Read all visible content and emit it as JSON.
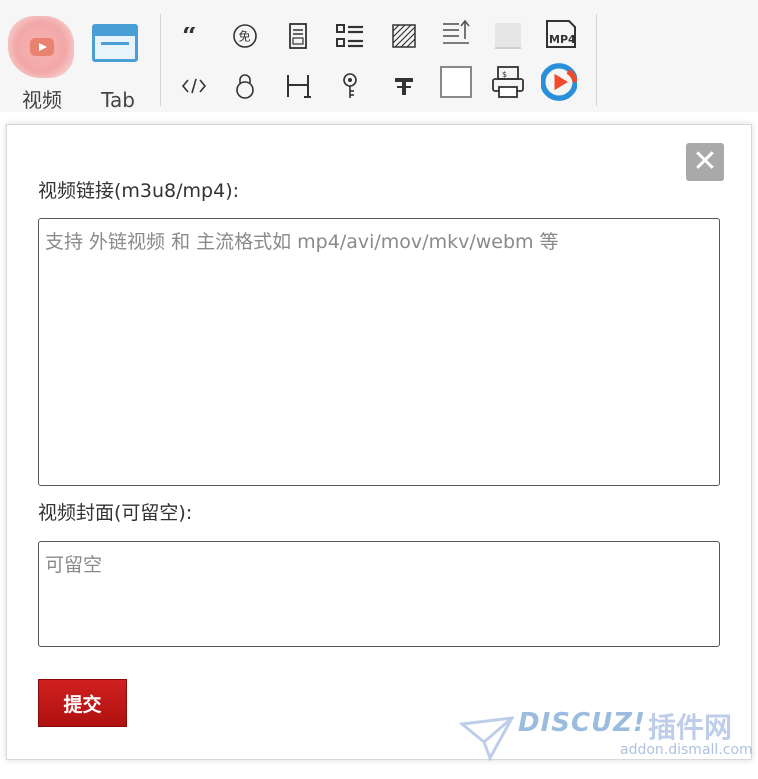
{
  "toolbar": {
    "video_label": "视频",
    "tab_label": "Tab",
    "icons": [
      "quote-icon",
      "free-icon",
      "document-icon",
      "list-icon",
      "hatch-icon",
      "sort-up-icon",
      "blank-icon",
      "mp4-icon",
      "code-icon",
      "lock-icon",
      "bracket-icon",
      "key-icon",
      "text-icon",
      "square-icon",
      "printer-icon",
      "play-logo-icon"
    ]
  },
  "dialog": {
    "close_glyph": "✕",
    "video_link_label": "视频链接(m3u8/mp4):",
    "video_link_placeholder": "支持 外链视频 和 主流格式如 mp4/avi/mov/mkv/webm 等",
    "cover_label": "视频封面(可留空):",
    "cover_placeholder": "可留空",
    "submit_label": "提交"
  },
  "watermark": {
    "brand": "DISCUZ!",
    "cn": "插件网",
    "url": "addon.dismall.com"
  },
  "colors": {
    "accent_blue": "#4a9ed6",
    "submit_red": "#c01818",
    "close_gray": "#a9a9a9"
  }
}
